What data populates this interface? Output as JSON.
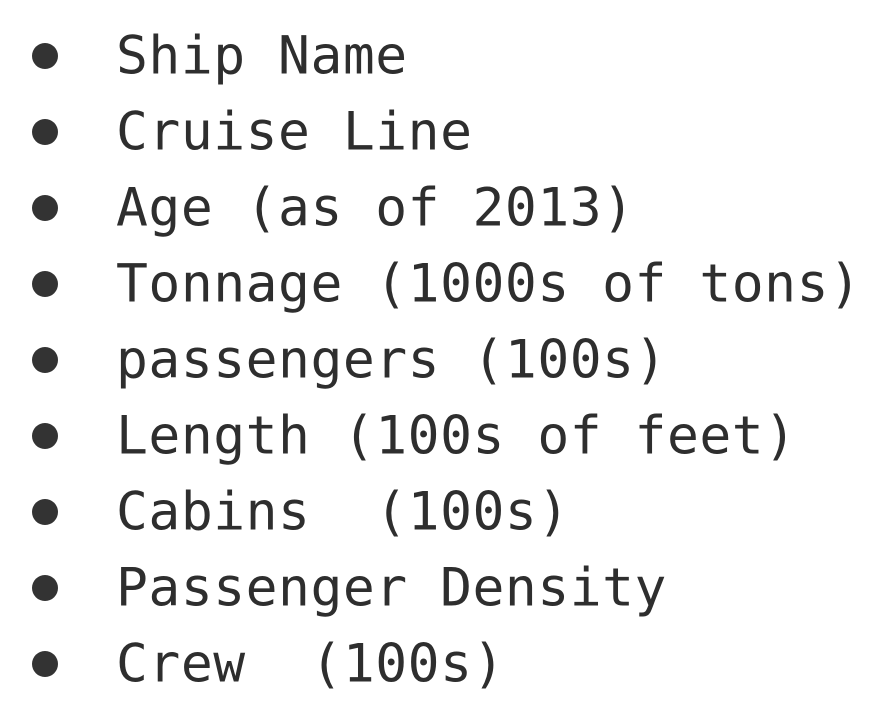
{
  "list": {
    "items": [
      {
        "label": "Ship Name"
      },
      {
        "label": "Cruise Line"
      },
      {
        "label": "Age (as of 2013)"
      },
      {
        "label": "Tonnage (1000s of tons)"
      },
      {
        "label": "passengers (100s)"
      },
      {
        "label": "Length (100s of feet)"
      },
      {
        "label": "Cabins  (100s)"
      },
      {
        "label": "Passenger Density"
      },
      {
        "label": "Crew  (100s)"
      }
    ]
  },
  "colors": {
    "text": "#2e2e2e",
    "bullet": "#333333",
    "background": "#ffffff"
  }
}
